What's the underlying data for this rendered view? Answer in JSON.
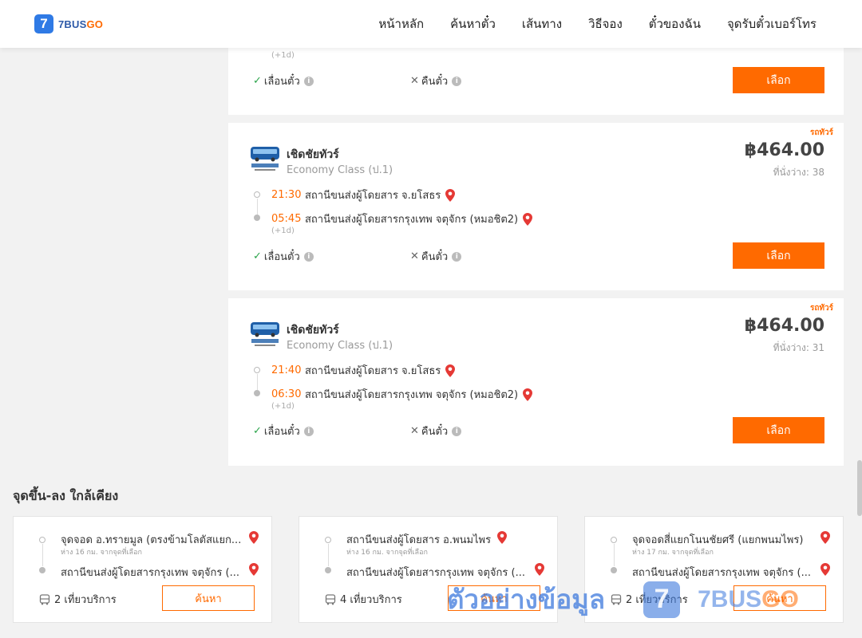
{
  "header": {
    "logo_mark": "7",
    "logo_text_main": "7BUS",
    "logo_text_accent": "GO",
    "nav": [
      "หน้าหลัก",
      "ค้นหาตั๋ว",
      "เส้นทาง",
      "วิธีจอง",
      "ตั๋วของฉัน",
      "จุดรับตั๋วเบอร์โทร"
    ]
  },
  "top_card": {
    "plus_day": "(+1d)",
    "change_label": "เลื่อนตั๋ว",
    "refund_label": "คืนตั๋ว",
    "select_label": "เลือก"
  },
  "trips": [
    {
      "tag": "รถทัวร์",
      "operator": "เชิดชัยทัวร์",
      "class": "Economy Class (ป.1)",
      "price": "฿464.00",
      "seats": "ที่นั่งว่าง: 38",
      "depart_time": "21:30",
      "depart_place": "สถานีขนส่งผู้โดยสาร จ.ยโสธร",
      "arrive_time": "05:45",
      "arrive_place": "สถานีขนส่งผู้โดยสารกรุงเทพ จตุจักร (หมอชิต2)",
      "plus_day": "(+1d)",
      "change_label": "เลื่อนตั๋ว",
      "refund_label": "คืนตั๋ว",
      "select_label": "เลือก"
    },
    {
      "tag": "รถทัวร์",
      "operator": "เชิดชัยทัวร์",
      "class": "Economy Class (ป.1)",
      "price": "฿464.00",
      "seats": "ที่นั่งว่าง: 31",
      "depart_time": "21:40",
      "depart_place": "สถานีขนส่งผู้โดยสาร จ.ยโสธร",
      "arrive_time": "06:30",
      "arrive_place": "สถานีขนส่งผู้โดยสารกรุงเทพ จตุจักร (หมอชิต2)",
      "plus_day": "(+1d)",
      "change_label": "เลื่อนตั๋ว",
      "refund_label": "คืนตั๋ว",
      "select_label": "เลือก"
    }
  ],
  "nearby": {
    "title": "จุดขึ้น-ลง ใกล้เคียง",
    "items": [
      {
        "from": "จุดจอด อ.ทรายมูล (ตรงข้ามโลตัสแยก...",
        "distance": "ห่าง 16 กม. จากจุดที่เลือก",
        "to": "สถานีขนส่งผู้โดยสารกรุงเทพ จตุจักร (...",
        "trips": "2 เที่ยวบริการ",
        "button": "ค้นหา"
      },
      {
        "from": "สถานีขนส่งผู้โดยสาร อ.พนมไพร",
        "distance": "ห่าง 16 กม. จากจุดที่เลือก",
        "to": "สถานีขนส่งผู้โดยสารกรุงเทพ จตุจักร (...",
        "trips": "4 เที่ยวบริการ",
        "button": "ค้นหา"
      },
      {
        "from": "จุดจอดสี่แยกโนนชัยศรี (แยกพนมไพร)",
        "distance": "ห่าง 17 กม. จากจุดที่เลือก",
        "to": "สถานีขนส่งผู้โดยสารกรุงเทพ จตุจักร (...",
        "trips": "2 เที่ยวบริการ",
        "button": "ค้นหา"
      }
    ]
  },
  "watermark": {
    "text": "ตัวอย่างข้อมูล",
    "mark": "7",
    "brand_main": "7BUS",
    "brand_accent": "GO"
  },
  "colors": {
    "accent": "#ff6a00",
    "brand_blue": "#2f7ae5",
    "check_green": "#2aa44a",
    "pin_red": "#e53935"
  }
}
